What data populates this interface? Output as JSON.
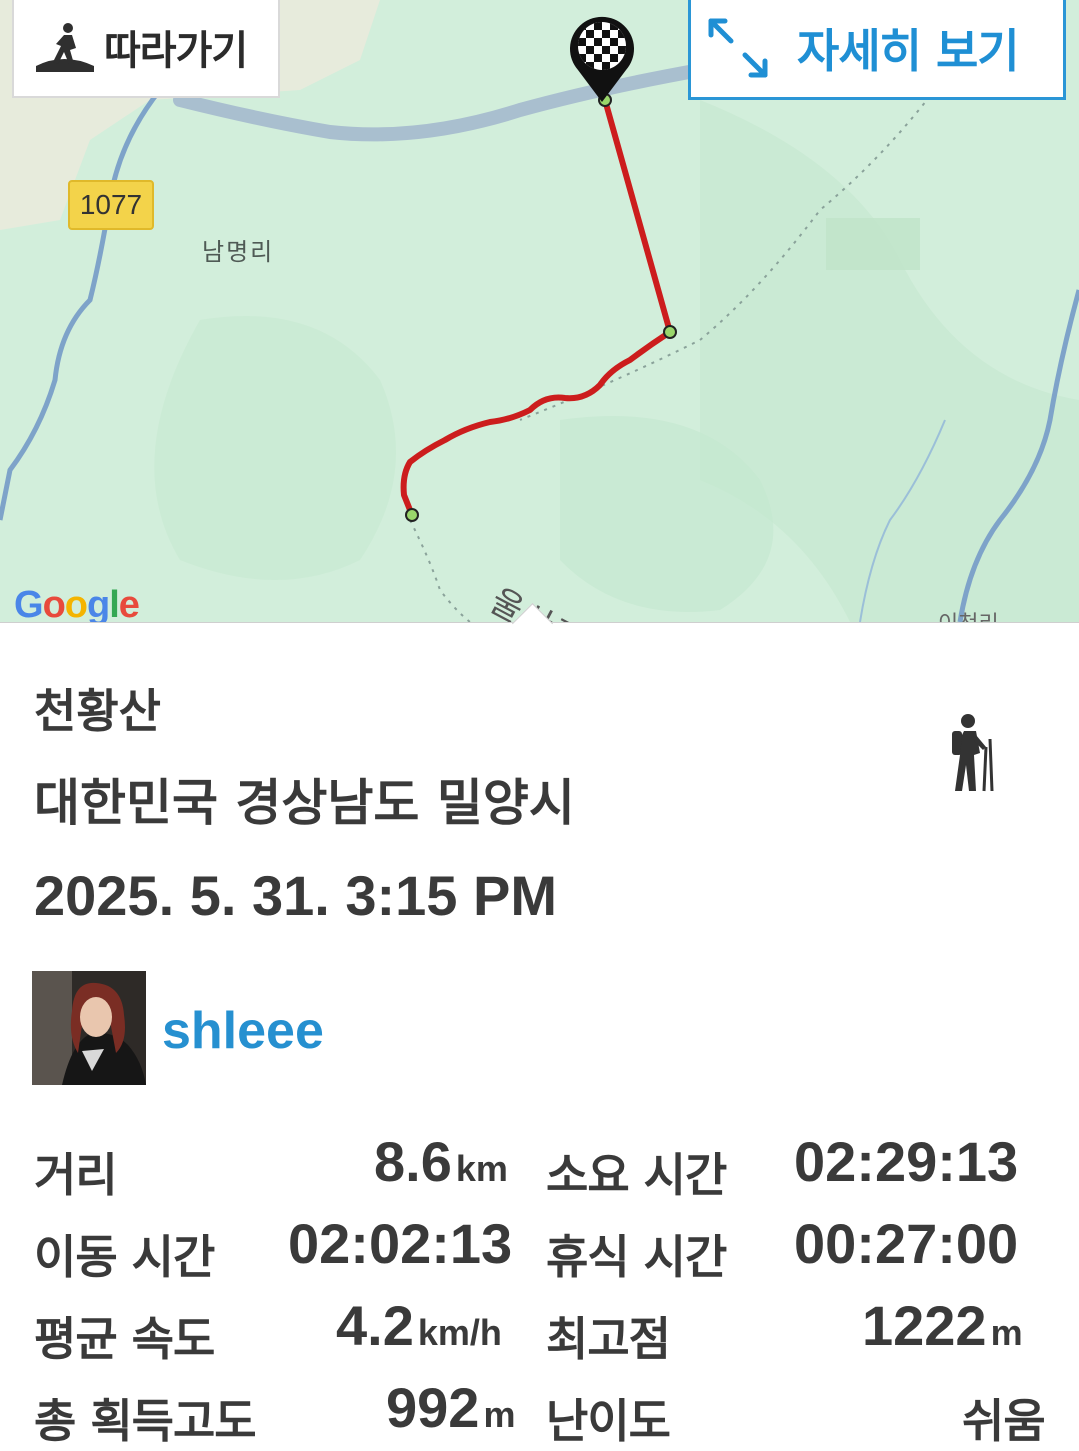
{
  "map": {
    "follow_label": "따라가기",
    "detail_label": "자세히 보기",
    "road_number": "1077",
    "village_label": "남명리",
    "road_label": "울산광역",
    "place_label": "이천리",
    "google_logo": "Google",
    "colors": {
      "route": "#cc1d1d",
      "accent": "#1f8fd4",
      "terrain": "#d2eedb",
      "road": "#a9bfcf"
    }
  },
  "trail": {
    "name": "천황산",
    "location": "대한민국 경상남도 밀양시",
    "datetime": "2025. 5. 31. 3:15 PM",
    "activity_icon": "hiker-icon"
  },
  "user": {
    "name": "shleee"
  },
  "stats": {
    "distance": {
      "label": "거리",
      "value": "8.6",
      "unit": "km"
    },
    "duration": {
      "label": "소요 시간",
      "value": "02:29:13"
    },
    "moving_time": {
      "label": "이동 시간",
      "value": "02:02:13"
    },
    "rest_time": {
      "label": "휴식 시간",
      "value": "00:27:00"
    },
    "avg_speed": {
      "label": "평균 속도",
      "value": "4.2",
      "unit": "km/h"
    },
    "max_altitude": {
      "label": "최고점",
      "value": "1222",
      "unit": "m"
    },
    "total_ascent": {
      "label": "총 획득고도",
      "value": "992",
      "unit": "m"
    },
    "difficulty": {
      "label": "난이도",
      "value": "쉬움"
    }
  }
}
